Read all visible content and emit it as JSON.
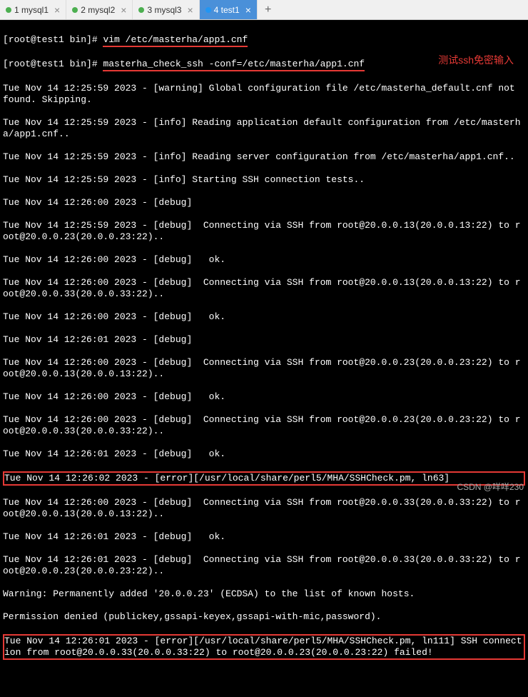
{
  "tabs": [
    {
      "label": "1 mysql1",
      "active": false,
      "dot": "green"
    },
    {
      "label": "2 mysql2",
      "active": false,
      "dot": "green"
    },
    {
      "label": "3 mysql3",
      "active": false,
      "dot": "green"
    },
    {
      "label": "4 test1",
      "active": true,
      "dot": "blue"
    }
  ],
  "tab_add": "+",
  "annotation": "测试ssh免密输入",
  "watermark": "CSDN @咩咩230",
  "prompt1": "[root@test1 bin]# ",
  "cmd1": "vim /etc/masterha/app1.cnf",
  "prompt2": "[root@test1 bin]# ",
  "cmd2": "masterha_check_ssh -conf=/etc/masterha/app1.cnf",
  "lines": {
    "l1": "Tue Nov 14 12:25:59 2023 - [warning] Global configuration file /etc/masterha_default.cnf not found. Skipping.",
    "l2": "Tue Nov 14 12:25:59 2023 - [info] Reading application default configuration from /etc/masterha/app1.cnf..",
    "l3": "Tue Nov 14 12:25:59 2023 - [info] Reading server configuration from /etc/masterha/app1.cnf..",
    "l4": "Tue Nov 14 12:25:59 2023 - [info] Starting SSH connection tests..",
    "l5": "Tue Nov 14 12:26:00 2023 - [debug] ",
    "l6": "Tue Nov 14 12:25:59 2023 - [debug]  Connecting via SSH from root@20.0.0.13(20.0.0.13:22) to root@20.0.0.23(20.0.0.23:22)..",
    "l7": "Tue Nov 14 12:26:00 2023 - [debug]   ok.",
    "l8": "Tue Nov 14 12:26:00 2023 - [debug]  Connecting via SSH from root@20.0.0.13(20.0.0.13:22) to root@20.0.0.33(20.0.0.33:22)..",
    "l9": "Tue Nov 14 12:26:00 2023 - [debug]   ok.",
    "l10": "Tue Nov 14 12:26:01 2023 - [debug] ",
    "l11": "Tue Nov 14 12:26:00 2023 - [debug]  Connecting via SSH from root@20.0.0.23(20.0.0.23:22) to root@20.0.0.13(20.0.0.13:22)..",
    "l12": "Tue Nov 14 12:26:00 2023 - [debug]   ok.",
    "l13": "Tue Nov 14 12:26:00 2023 - [debug]  Connecting via SSH from root@20.0.0.23(20.0.0.23:22) to root@20.0.0.33(20.0.0.33:22)..",
    "l14": "Tue Nov 14 12:26:01 2023 - [debug]   ok.",
    "l15": "Tue Nov 14 12:26:02 2023 - [error][/usr/local/share/perl5/MHA/SSHCheck.pm, ln63] ",
    "l16": "Tue Nov 14 12:26:00 2023 - [debug]  Connecting via SSH from root@20.0.0.33(20.0.0.33:22) to root@20.0.0.13(20.0.0.13:22)..",
    "l17": "Tue Nov 14 12:26:01 2023 - [debug]   ok.",
    "l18": "Tue Nov 14 12:26:01 2023 - [debug]  Connecting via SSH from root@20.0.0.33(20.0.0.33:22) to root@20.0.0.23(20.0.0.23:22)..",
    "l19": "Warning: Permanently added '20.0.0.23' (ECDSA) to the list of known hosts.",
    "l20": "Permission denied (publickey,gssapi-keyex,gssapi-with-mic,password).",
    "l21": "Tue Nov 14 12:26:01 2023 - [error][/usr/local/share/perl5/MHA/SSHCheck.pm, ln111] SSH connection from root@20.0.0.33(20.0.0.33:22) to root@20.0.0.23(20.0.0.23:22) failed!"
  }
}
